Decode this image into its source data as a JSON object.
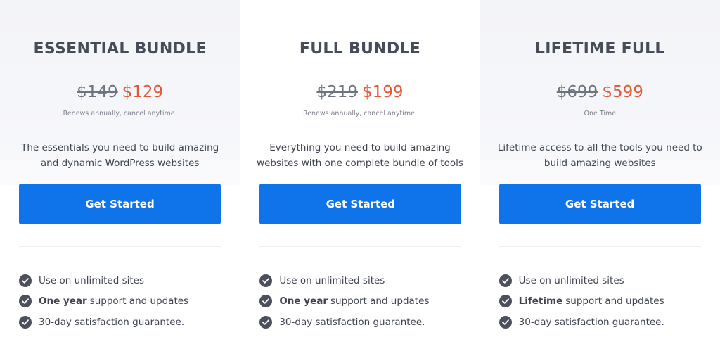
{
  "plans": [
    {
      "title": "ESSENTIAL BUNDLE",
      "old_price": "$149",
      "new_price": "$129",
      "billing_note": "Renews annually, cancel anytime.",
      "description_line1": "The essentials you need to build amazing",
      "description_line2": "and dynamic WordPress websites",
      "cta_label": "Get Started",
      "features": [
        {
          "bold": "",
          "text": "Use on unlimited sites"
        },
        {
          "bold": "One year",
          "text": "support and updates"
        },
        {
          "bold": "",
          "text": "30-day satisfaction guarantee."
        }
      ]
    },
    {
      "title": "FULL BUNDLE",
      "old_price": "$219",
      "new_price": "$199",
      "billing_note": "Renews annually, cancel anytime.",
      "description_line1": "Everything you need to build amazing",
      "description_line2": "websites with one complete bundle of tools",
      "cta_label": "Get Started",
      "features": [
        {
          "bold": "",
          "text": "Use on unlimited sites"
        },
        {
          "bold": "One year",
          "text": "support and updates"
        },
        {
          "bold": "",
          "text": "30-day satisfaction guarantee."
        }
      ]
    },
    {
      "title": "LIFETIME FULL",
      "old_price": "$699",
      "new_price": "$599",
      "billing_note": "One Time",
      "description_line1": "Lifetime access to all the tools you need to",
      "description_line2": "build amazing websites",
      "cta_label": "Get Started",
      "features": [
        {
          "bold": "",
          "text": "Use on unlimited sites"
        },
        {
          "bold": "Lifetime",
          "text": "support and updates"
        },
        {
          "bold": "",
          "text": "30-day satisfaction guarantee."
        }
      ]
    }
  ],
  "colors": {
    "accent": "#0f73ea",
    "sale_price": "#de5a3a",
    "heading": "#474c59",
    "check_icon": "#4b505c"
  },
  "icons": {
    "feature_bullet": "check-circle-icon"
  }
}
